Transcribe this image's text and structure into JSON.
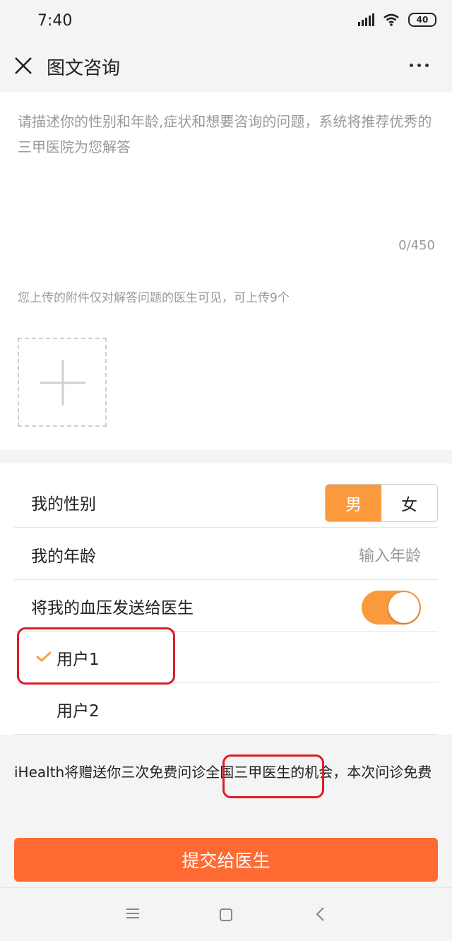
{
  "status_bar": {
    "time": "7:40",
    "battery": "40"
  },
  "header": {
    "title": "图文咨询"
  },
  "consult": {
    "placeholder": "请描述你的性别和年龄,症状和想要咨询的问题，系统将推荐优秀的三甲医院为您解答",
    "char_count": "0/450",
    "attach_hint": "您上传的附件仅对解答问题的医生可见，可上传9个"
  },
  "settings": {
    "gender": {
      "label": "我的性别",
      "male": "男",
      "female": "女",
      "selected": "男"
    },
    "age": {
      "label": "我的年龄",
      "placeholder": "输入年龄"
    },
    "bp": {
      "label": "将我的血压发送给医生",
      "enabled": true
    },
    "users": [
      {
        "name": "用户1",
        "selected": true
      },
      {
        "name": "用户2",
        "selected": false
      }
    ]
  },
  "promo": {
    "before": "iHealth将赠送你三次免费问诊",
    "highlight": "全国三甲医生",
    "after": "的机会，本次问诊免费"
  },
  "submit": {
    "label": "提交给医生"
  },
  "colors": {
    "accent": "#fa9a3d",
    "submit": "#ff6a33",
    "highlight": "#d81e28"
  }
}
